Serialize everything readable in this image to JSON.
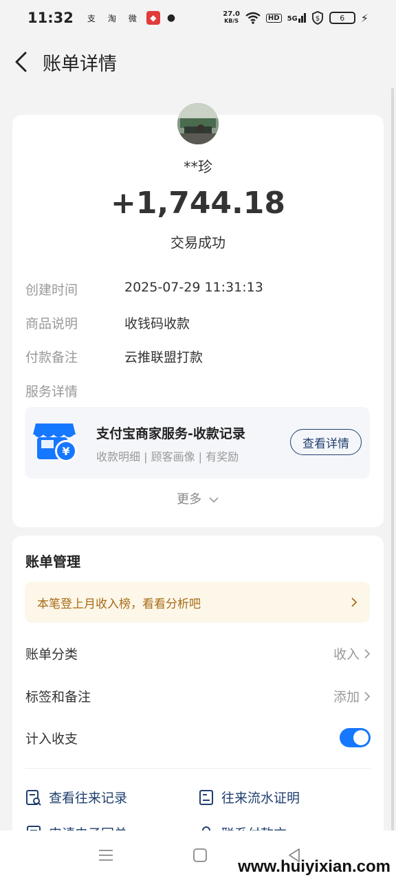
{
  "status_bar": {
    "time": "11:32",
    "apps": [
      "支",
      "淘",
      "微",
      "◆"
    ],
    "net_speed_value": "27.0",
    "net_speed_unit": "KB/S",
    "hd": "HD",
    "signal": "5G",
    "battery": "6"
  },
  "header": {
    "title": "账单详情"
  },
  "summary": {
    "name": "**珍",
    "amount": "+1,744.18",
    "status": "交易成功",
    "rows": [
      {
        "label": "创建时间",
        "value": "2025-07-29 11:31:13"
      },
      {
        "label": "商品说明",
        "value": "收钱码收款"
      },
      {
        "label": "付款备注",
        "value": "云推联盟打款"
      },
      {
        "label": "服务详情",
        "value": ""
      }
    ],
    "service": {
      "title": "支付宝商家服务-收款记录",
      "subtitle": "收款明细 | 顾客画像 | 有奖励",
      "button": "查看详情"
    },
    "more": "更多"
  },
  "management": {
    "title": "账单管理",
    "promo": "本笔登上月收入榜，看看分析吧",
    "category_label": "账单分类",
    "category_value": "收入",
    "tags_label": "标签和备注",
    "tags_value": "添加",
    "include_label": "计入收支",
    "include_on": true,
    "links": [
      {
        "label": "查看往来记录"
      },
      {
        "label": "往来流水证明"
      },
      {
        "label": "申请电子回单"
      },
      {
        "label": "联系付款方"
      }
    ]
  },
  "watermark": "www.huiyixian.com",
  "colors": {
    "accent": "#1677ff",
    "link": "#1f3f6e",
    "promo_text": "#a86a13",
    "promo_bg": "#fdf7ea"
  }
}
